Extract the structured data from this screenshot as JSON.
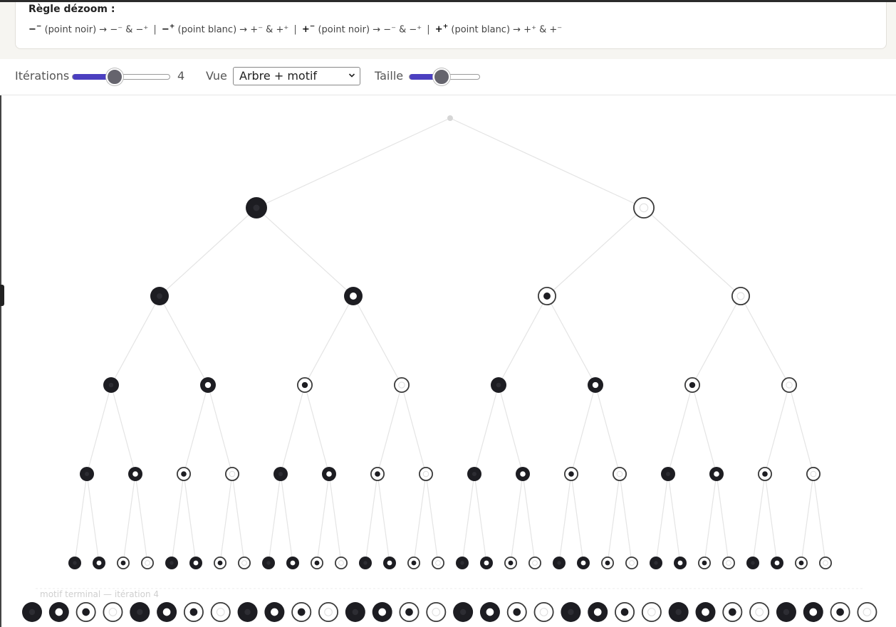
{
  "rule": {
    "title": "Règle dézoom :",
    "items": [
      {
        "sym": "−",
        "sup": "−",
        "desc": " (point noir) → −⁻ & −⁺"
      },
      {
        "sym": "−",
        "sup": "+",
        "desc": " (point blanc) → +⁻ & +⁺"
      },
      {
        "sym": "+",
        "sup": "−",
        "desc": " (point noir) → −⁻ & −⁺"
      },
      {
        "sym": "+",
        "sup": "+",
        "desc": " (point blanc) → +⁺ & +⁻"
      }
    ],
    "separator": "|"
  },
  "controls": {
    "iterations_label": "Itérations",
    "iterations_value": "4",
    "iterations_fraction": 0.43,
    "view_label": "Vue",
    "view_selected": "Arbre + motif",
    "size_label": "Taille",
    "size_fraction": 0.45
  },
  "tree": {
    "levels": [
      [
        "root"
      ],
      [
        "B",
        "W"
      ],
      [
        "B",
        "BW",
        "WB",
        "W"
      ],
      [
        "B",
        "BW",
        "WB",
        "W",
        "B",
        "BW",
        "WB",
        "W"
      ],
      [
        "B",
        "BW",
        "WB",
        "W",
        "B",
        "BW",
        "WB",
        "W",
        "B",
        "BW",
        "WB",
        "W",
        "B",
        "BW",
        "WB",
        "W"
      ],
      [
        "B",
        "BW",
        "WB",
        "W",
        "B",
        "BW",
        "WB",
        "W",
        "B",
        "BW",
        "WB",
        "W",
        "B",
        "BW",
        "WB",
        "W",
        "B",
        "BW",
        "WB",
        "W",
        "B",
        "BW",
        "WB",
        "W",
        "B",
        "BW",
        "WB",
        "W",
        "B",
        "BW",
        "WB",
        "W"
      ]
    ]
  },
  "motif": {
    "label": "motif terminal — itération 4",
    "pattern": [
      "B",
      "BW",
      "WB",
      "W",
      "B",
      "BW",
      "WB",
      "W",
      "B",
      "BW",
      "WB",
      "W",
      "B",
      "BW",
      "WB",
      "W",
      "B",
      "BW",
      "WB",
      "W",
      "B",
      "BW",
      "WB",
      "W",
      "B",
      "BW",
      "WB",
      "W",
      "B",
      "BW",
      "WB",
      "W"
    ]
  },
  "colors": {
    "accent": "#4b3fc0",
    "node_dark": "#1d1d22",
    "node_light_border": "#3a3a3a",
    "edge": "#e4e4e4"
  }
}
